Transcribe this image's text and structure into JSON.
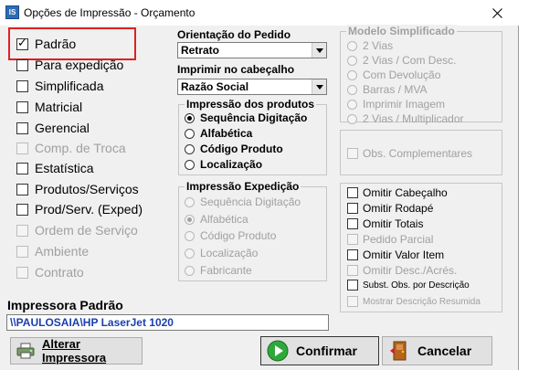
{
  "window": {
    "title": "Opções de Impressão - Orçamento",
    "app_icon_text": "IS"
  },
  "left_options": [
    {
      "label": "Padrão",
      "checked": true,
      "enabled": true
    },
    {
      "label": "Para expedição",
      "checked": false,
      "enabled": true
    },
    {
      "label": "Simplificada",
      "checked": false,
      "enabled": true
    },
    {
      "label": "Matricial",
      "checked": false,
      "enabled": true
    },
    {
      "label": "Gerencial",
      "checked": false,
      "enabled": true
    },
    {
      "label": "Comp. de Troca",
      "checked": false,
      "enabled": false
    },
    {
      "label": "Estatística",
      "checked": false,
      "enabled": true
    },
    {
      "label": "Produtos/Serviços",
      "checked": false,
      "enabled": true
    },
    {
      "label": "Prod/Serv. (Exped)",
      "checked": false,
      "enabled": true
    },
    {
      "label": "Ordem de Serviço",
      "checked": false,
      "enabled": false
    },
    {
      "label": "Ambiente",
      "checked": false,
      "enabled": false
    },
    {
      "label": "Contrato",
      "checked": false,
      "enabled": false
    }
  ],
  "orientation": {
    "label": "Orientação do Pedido",
    "value": "Retrato"
  },
  "header_print": {
    "label": "Imprimir no cabeçalho",
    "value": "Razão Social"
  },
  "products_group": {
    "title": "Impressão dos produtos",
    "options": [
      {
        "label": "Sequência Digitação",
        "selected": true
      },
      {
        "label": "Alfabética",
        "selected": false
      },
      {
        "label": "Código Produto",
        "selected": false
      },
      {
        "label": "Localização",
        "selected": false
      }
    ]
  },
  "expedition_group": {
    "title": "Impressão Expedição",
    "options": [
      {
        "label": "Sequência Digitação",
        "selected": false
      },
      {
        "label": "Alfabética",
        "selected": true
      },
      {
        "label": "Código Produto",
        "selected": false
      },
      {
        "label": "Localização",
        "selected": false
      },
      {
        "label": "Fabricante",
        "selected": false
      }
    ]
  },
  "simplified_group": {
    "title": "Modelo Simplificado",
    "options": [
      {
        "label": "2 Vias"
      },
      {
        "label": "2 Vias / Com Desc."
      },
      {
        "label": "Com Devolução"
      },
      {
        "label": "Barras / MVA"
      },
      {
        "label": "Imprimir Imagem"
      },
      {
        "label": "2 Vias / Multiplicador"
      }
    ]
  },
  "obs_complementares": {
    "label": "Obs. Complementares",
    "enabled": false
  },
  "right_options": [
    {
      "label": "Omitir Cabeçalho",
      "enabled": true
    },
    {
      "label": "Omitir Rodapé",
      "enabled": true
    },
    {
      "label": "Omitir Totais",
      "enabled": true
    },
    {
      "label": "Pedido Parcial",
      "enabled": false
    },
    {
      "label": "Omitir Valor Item",
      "enabled": true
    },
    {
      "label": "Omitir Desc./Acrés.",
      "enabled": false
    },
    {
      "label": "Subst. Obs. por Descrição",
      "enabled": true
    },
    {
      "label": "Mostrar Descrição Resumida",
      "enabled": false
    }
  ],
  "printer": {
    "label": "Impressora Padrão",
    "value": "\\\\PAULOSAIA\\HP LaserJet 1020"
  },
  "buttons": {
    "alter_printer": "Alterar Impressora",
    "confirm": "Confirmar",
    "cancel": "Cancelar"
  }
}
